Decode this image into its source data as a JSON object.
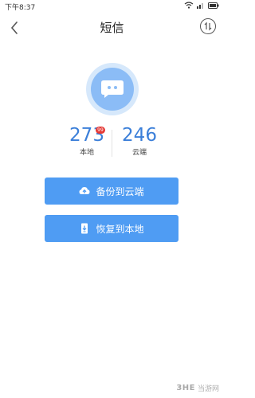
{
  "status_bar": {
    "time": "下午8:37"
  },
  "header": {
    "title": "短信"
  },
  "counts": {
    "local": {
      "value": "273",
      "label": "本地",
      "badge": "99"
    },
    "cloud": {
      "value": "246",
      "label": "云端"
    }
  },
  "actions": {
    "backup_label": "备份到云端",
    "restore_label": "恢复到本地"
  },
  "watermark": {
    "logo": "3HE",
    "text": "当游网"
  },
  "colors": {
    "accent": "#4f9cf3",
    "count_text": "#3b7fd9",
    "badge": "#e53935",
    "avatar_outer": "#d6e8fb",
    "avatar_inner": "#8bbcf6"
  },
  "icons": {
    "back": "chevron-left-icon",
    "menu": "sort-arrows-icon",
    "avatar": "chat-bubble-icon",
    "backup": "cloud-upload-icon",
    "restore": "phone-download-icon"
  }
}
